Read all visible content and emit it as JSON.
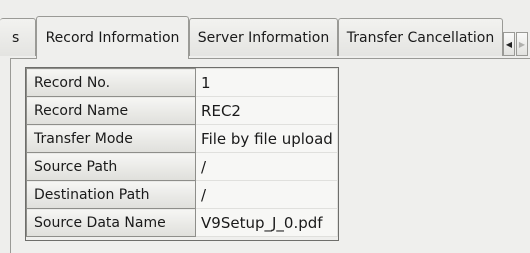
{
  "tabs": {
    "partial_label": "s",
    "active_label": "Record Information",
    "server_label": "Server Information",
    "transfer_label": "Transfer Cancellation",
    "scroll_left_icon": "triangle-left-icon",
    "scroll_right_icon": "triangle-right-icon"
  },
  "properties": {
    "rows": [
      {
        "label": "Record No.",
        "value": "1"
      },
      {
        "label": "Record Name",
        "value": "REC2"
      },
      {
        "label": "Transfer Mode",
        "value": "File by file upload"
      },
      {
        "label": "Source Path",
        "value": "/"
      },
      {
        "label": "Destination Path",
        "value": "/"
      },
      {
        "label": "Source Data Name",
        "value": "V9Setup_J_0.pdf"
      }
    ]
  },
  "colors": {
    "background": "#eeeeec",
    "border": "#9a9a96"
  }
}
